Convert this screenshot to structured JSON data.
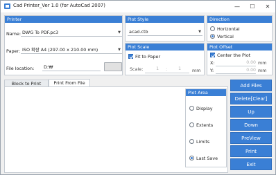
{
  "window": {
    "title": "Cad Printer_Ver 1.0 (for AutoCad 2007)",
    "controls": {
      "minimize": "—",
      "maximize": "☐",
      "close": "✕"
    }
  },
  "colors": {
    "accent": "#3a7fd5",
    "panel_bg": "#ffffff",
    "window_bg": "#f0f0f0"
  },
  "printer": {
    "header": "Printer",
    "name_label": "Name:",
    "name_value": "DWG To PDF.pc3",
    "paper_label": "Paper:",
    "paper_value": "ISO 확장 A4 (297.00 x 210.00 mm)",
    "location_label": "File location:",
    "location_value": "D:₩"
  },
  "plot_style": {
    "header": "Plot Style",
    "value": "acad.ctb"
  },
  "direction": {
    "header": "Direction",
    "options": [
      "Horizontal",
      "Vertical"
    ],
    "selected": "Vertical"
  },
  "plot_scale": {
    "header": "Plot Scale",
    "fit_label": "Fit to Paper",
    "fit_checked": true,
    "scale_label": "Scale:",
    "scale_num": "1",
    "scale_sep": ":",
    "scale_den": "1",
    "unit": "mm"
  },
  "plot_offset": {
    "header": "Plot Offset",
    "center_label": "Center the Plot",
    "center_checked": true,
    "x_label": "X:",
    "x_value": "0.00",
    "y_label": "Y:",
    "y_value": "0.00",
    "unit": "mm"
  },
  "tabs": [
    {
      "label": "Block to Print",
      "active": false
    },
    {
      "label": "Print From File",
      "active": true
    }
  ],
  "plot_area": {
    "header": "Plot Area",
    "options": [
      "Display",
      "Extents",
      "Limits",
      "Last Save"
    ],
    "selected": "Last Save"
  },
  "actions": [
    "Add Files",
    "Delete[Clear]",
    "Up",
    "Down",
    "PreView",
    "Print",
    "Exit"
  ]
}
